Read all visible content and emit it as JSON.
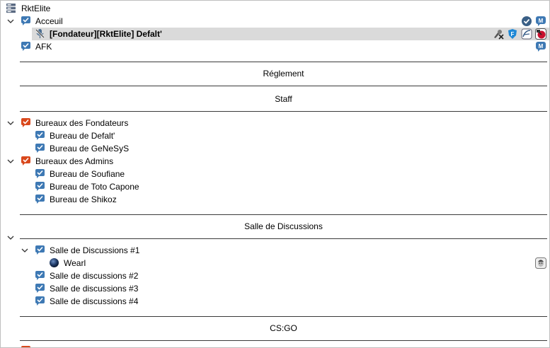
{
  "server": {
    "name": "RktElite"
  },
  "channels": {
    "accueil": "Acceuil",
    "afk": "AFK",
    "reglement": "Réglement",
    "staff": "Staff",
    "bureaux_fondateurs": "Bureaux des Fondateurs",
    "bureau_defalt": "Bureau de Defalt'",
    "bureau_genesys": "Bureau de GeNeSyS",
    "bureaux_admins": "Bureaux des Admins",
    "bureau_soufiane": "Bureau de Soufiane",
    "bureau_toto": "Bureau de Toto Capone",
    "bureau_shikoz": "Bureau de Shikoz",
    "salle_discussions": "Salle de Discussions",
    "salle_1": "Salle de Discussions #1",
    "salle_2": "Salle de discussions #2",
    "salle_3": "Salle de discussions #3",
    "salle_4": "Salle de discussions #4",
    "csgo": "CS:GO"
  },
  "users": {
    "defalt": "[Fondateur][RktElite] Defalt'",
    "wearl": "Wearl"
  },
  "colors": {
    "channel_icon": "#3e79b4",
    "channel_icon_restricted": "#d9481c",
    "selection": "#dadada",
    "separator": "#3a3a3a"
  },
  "icons": {
    "server": "server-icon",
    "channel": "channel-bubble-icon",
    "channel_restricted": "channel-restricted-icon",
    "muted_client": "muted-microphone-icon",
    "client": "client-idle-icon",
    "expand": "chevron-down-icon"
  }
}
